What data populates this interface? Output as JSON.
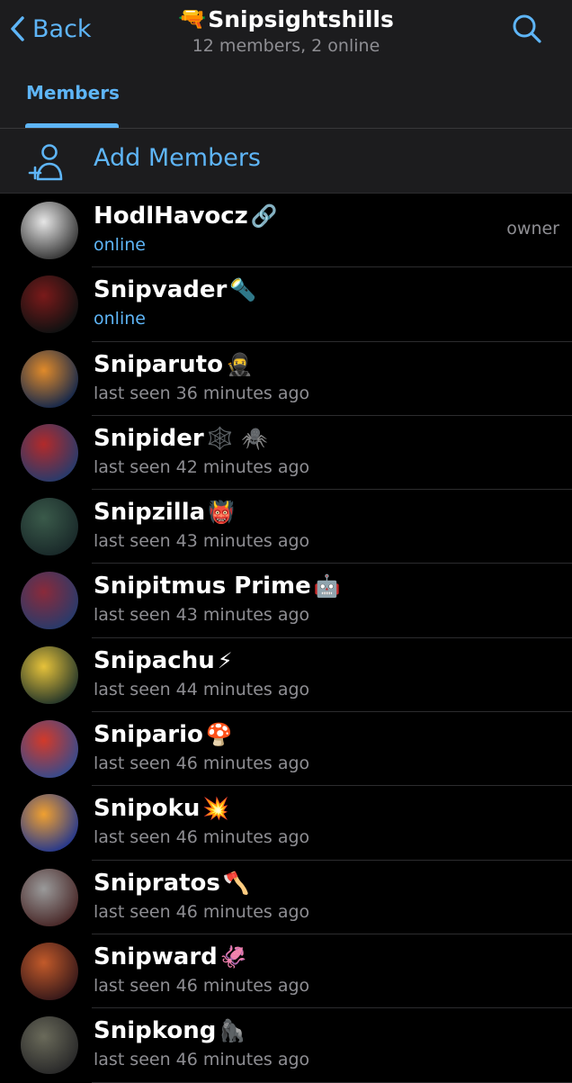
{
  "header": {
    "back_label": "Back",
    "title_icon": "🔫",
    "title": "Snipsightshills",
    "subtitle": "12 members, 2 online",
    "search_icon": "search-icon"
  },
  "tabs": [
    {
      "label": "Members",
      "active": true
    }
  ],
  "add_members": {
    "label": "Add Members",
    "icon": "add-person-icon"
  },
  "colors": {
    "accent": "#5eb5f7",
    "background": "#000000",
    "header_bg": "#1c1c1e",
    "secondary_text": "#8e8e93"
  },
  "members": [
    {
      "name": "HodlHavocz",
      "emoji": "🔗",
      "status": "online",
      "online": true,
      "role": "owner",
      "avatar": [
        "#e6e6e6",
        "#3a3a3a"
      ]
    },
    {
      "name": "Snipvader",
      "emoji": "🔦",
      "status": "online",
      "online": true,
      "role": "",
      "avatar": [
        "#7a1a1a",
        "#111111"
      ]
    },
    {
      "name": "Sniparuto",
      "emoji": "🥷",
      "status": "last seen 36 minutes ago",
      "online": false,
      "role": "",
      "avatar": [
        "#e08a2a",
        "#1a2a4a"
      ]
    },
    {
      "name": "Snipider",
      "emoji": "🕸️ 🕷️",
      "status": "last seen 42 minutes ago",
      "online": false,
      "role": "",
      "avatar": [
        "#b22a2a",
        "#2a3a6a"
      ]
    },
    {
      "name": "Snipzilla",
      "emoji": "👹",
      "status": "last seen 43 minutes ago",
      "online": false,
      "role": "",
      "avatar": [
        "#3a5a4a",
        "#1a2a2a"
      ]
    },
    {
      "name": "Snipitmus Prime",
      "emoji": "🤖",
      "status": "last seen 43 minutes ago",
      "online": false,
      "role": "",
      "avatar": [
        "#8a2a3a",
        "#2a3a6a"
      ]
    },
    {
      "name": "Snipachu",
      "emoji": "⚡",
      "status": "last seen 44 minutes ago",
      "online": false,
      "role": "",
      "avatar": [
        "#e6c23a",
        "#2a3a2a"
      ]
    },
    {
      "name": "Snipario",
      "emoji": "🍄",
      "status": "last seen 46 minutes ago",
      "online": false,
      "role": "",
      "avatar": [
        "#d23a2a",
        "#3a4a8a"
      ]
    },
    {
      "name": "Snipoku",
      "emoji": "💥",
      "status": "last seen 46 minutes ago",
      "online": false,
      "role": "",
      "avatar": [
        "#f0a030",
        "#2a3a8a"
      ]
    },
    {
      "name": "Snipratos",
      "emoji": "🪓",
      "status": "last seen 46 minutes ago",
      "online": false,
      "role": "",
      "avatar": [
        "#9a9a9a",
        "#4a2a2a"
      ]
    },
    {
      "name": "Snipward",
      "emoji": "🦑",
      "status": "last seen 46 minutes ago",
      "online": false,
      "role": "",
      "avatar": [
        "#c25a2a",
        "#3a1a1a"
      ]
    },
    {
      "name": "Snipkong",
      "emoji": "🦍",
      "status": "last seen 46 minutes ago",
      "online": false,
      "role": "",
      "avatar": [
        "#6a6a5a",
        "#2a2a2a"
      ]
    }
  ]
}
